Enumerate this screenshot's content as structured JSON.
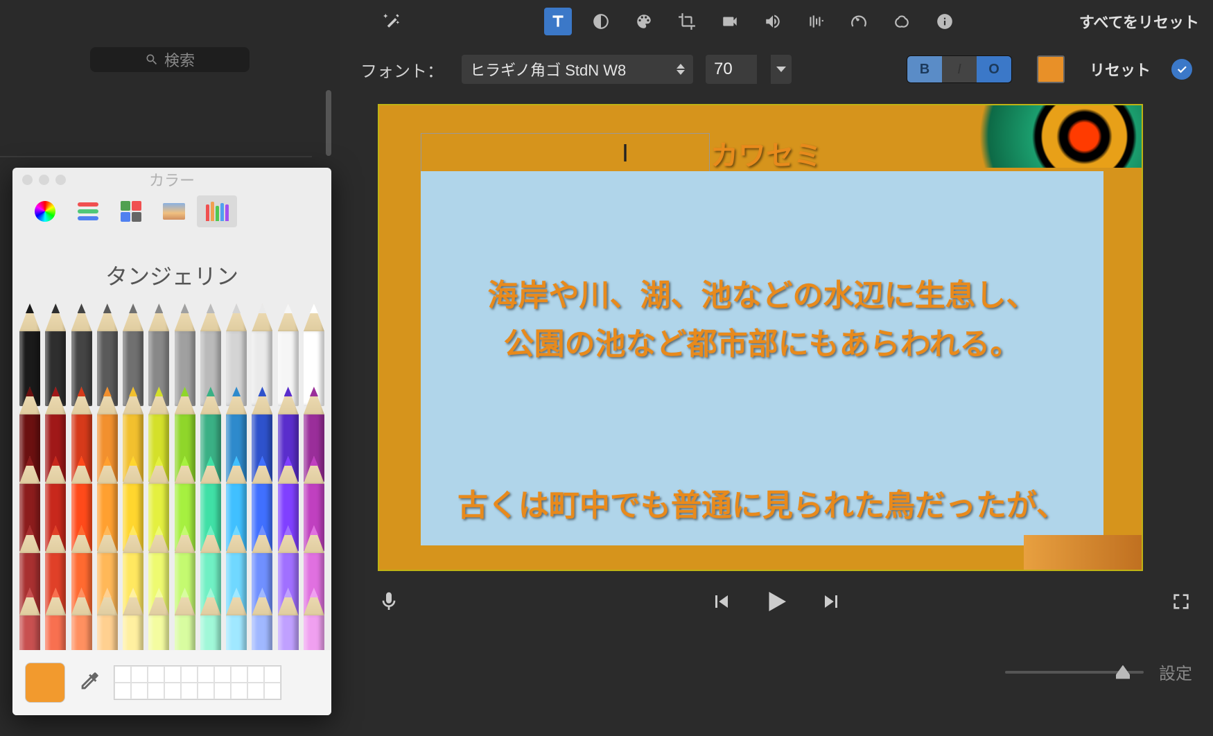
{
  "sidebar": {
    "search_placeholder": "検索"
  },
  "toolbar": {
    "reset_all": "すべてをリセット"
  },
  "optbar": {
    "font_label": "フォント：",
    "font_name": "ヒラギノ角ゴ StdN W8",
    "font_size": "70",
    "style_b": "B",
    "style_i": "I",
    "style_o": "O",
    "reset": "リセット",
    "color_chip": "#e89028"
  },
  "preview": {
    "title": "カワセミ",
    "line1": "海岸や川、湖、池などの水辺に生息し、",
    "line2": "公園の池など都市部にもあらわれる。",
    "line3": "古くは町中でも普通に見られた鳥だったが、"
  },
  "bottombar": {
    "settings": "設定"
  },
  "color_window": {
    "title": "カラー",
    "color_name": "タンジェリン",
    "current_swatch": "#f29a2e",
    "gray_row": [
      "#1a1a1a",
      "#2e2e2e",
      "#444",
      "#5a5a5a",
      "#707070",
      "#888",
      "#a0a0a0",
      "#bababa",
      "#d4d4d4",
      "#eaeaea",
      "#f6f6f6",
      "#fff"
    ],
    "row2": [
      "#6b1010",
      "#a01818",
      "#d63a1a",
      "#f2902e",
      "#f2c02e",
      "#d4e02a",
      "#8fd62a",
      "#3ab085",
      "#2e8acc",
      "#2e52cc",
      "#5a2ecc",
      "#9a2e9a"
    ],
    "row3": [
      "#8c1c1c",
      "#c8281c",
      "#ff4a1a",
      "#ffa030",
      "#ffd62e",
      "#e4f040",
      "#a6f040",
      "#40e0a6",
      "#40c0ff",
      "#4070ff",
      "#8040ff",
      "#c040c0"
    ],
    "row4": [
      "#a83030",
      "#e04028",
      "#ff6a30",
      "#ffb858",
      "#ffe860",
      "#eefa70",
      "#c4fa70",
      "#70f0c4",
      "#70d8ff",
      "#7090ff",
      "#a070ff",
      "#e070e0"
    ],
    "row5": [
      "#c85050",
      "#f87050",
      "#ff9060",
      "#ffd090",
      "#fff0a0",
      "#f4fca0",
      "#d8fca0",
      "#a0f8d8",
      "#a0e8ff",
      "#a0b8ff",
      "#c0a0ff",
      "#f0a0f0"
    ]
  }
}
